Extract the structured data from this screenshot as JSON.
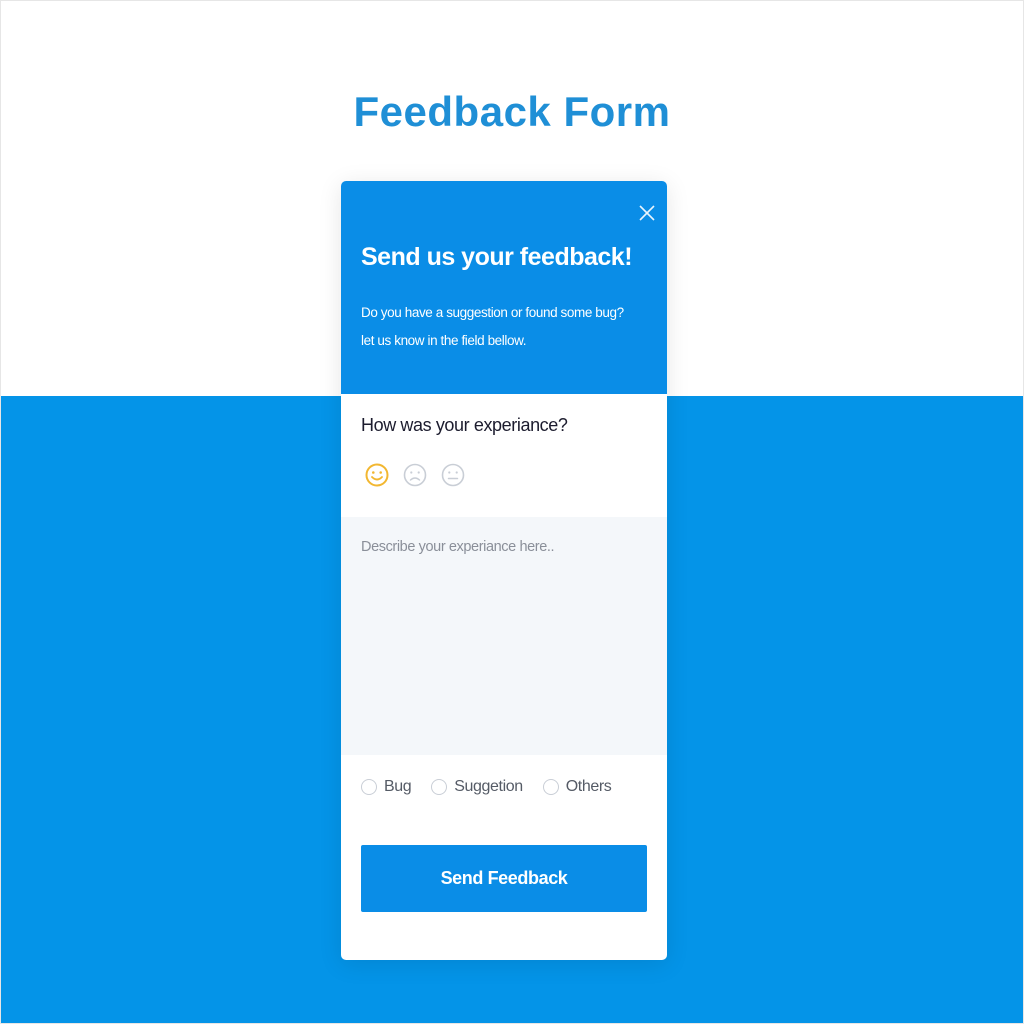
{
  "page": {
    "title": "Feedback Form"
  },
  "colors": {
    "accent": "#0a8de7",
    "title_blue": "#1f8fd6",
    "background_blue": "#0494e8",
    "selected_emoji": "#f2b731",
    "unselected_emoji": "#c9ced6",
    "textarea_bg": "#f4f7fa"
  },
  "card": {
    "close_icon": "close-icon",
    "header_title": "Send us your feedback!",
    "header_line1": "Do you have a suggestion or found some bug?",
    "header_line2": "let us know in the field bellow.",
    "question": "How was your experiance?",
    "emojis": [
      {
        "icon": "smile-icon",
        "selected": true
      },
      {
        "icon": "frown-icon",
        "selected": false
      },
      {
        "icon": "neutral-icon",
        "selected": false
      }
    ],
    "textarea_placeholder": "Describe your experiance here..",
    "radio_options": [
      {
        "label": "Bug",
        "checked": false
      },
      {
        "label": "Suggetion",
        "checked": false
      },
      {
        "label": "Others",
        "checked": false
      }
    ],
    "submit_label": "Send Feedback"
  }
}
